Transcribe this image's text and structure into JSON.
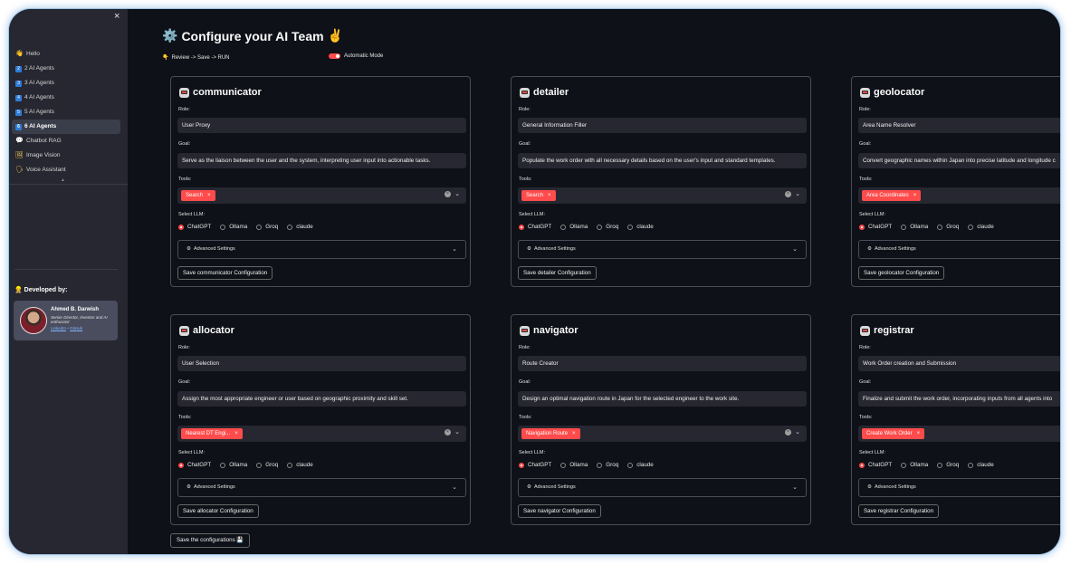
{
  "sidebar": {
    "close_label": "×",
    "items": [
      {
        "icon": "wave-hand-icon",
        "glyph": "👋",
        "label": "Hello",
        "active": false
      },
      {
        "icon": "keycap-2-icon",
        "glyph": "2",
        "label": "2 AI Agents",
        "active": false
      },
      {
        "icon": "keycap-3-icon",
        "glyph": "3",
        "label": "3 AI Agents",
        "active": false
      },
      {
        "icon": "keycap-4-icon",
        "glyph": "4",
        "label": "4 AI Agents",
        "active": false
      },
      {
        "icon": "keycap-5-icon",
        "glyph": "5",
        "label": "5 AI Agents",
        "active": false
      },
      {
        "icon": "keycap-6-icon",
        "glyph": "6",
        "label": "6 AI Agents",
        "active": true
      },
      {
        "icon": "speech-bubble-icon",
        "glyph": "💬",
        "label": "Chatbot RAG",
        "active": false
      },
      {
        "icon": "picture-icon",
        "glyph": "🖼",
        "label": "Image Vision",
        "active": false
      },
      {
        "icon": "microphone-icon",
        "glyph": "🗣",
        "label": "Voice Assistant",
        "active": false
      }
    ],
    "developed_by": "Developed by:",
    "developer": {
      "name": "Ahmed B. Darwish",
      "description": "Senior Director, Inventor and AI enthusiast",
      "link1": "LinkedIn",
      "link_sep": "•",
      "link2": "GitHub"
    }
  },
  "header": {
    "title": "Configure your AI Team",
    "subtitle": "Review -> Save -> RUN",
    "toggle_label": "Automatic Mode"
  },
  "labels": {
    "role": "Role:",
    "goal": "Goal:",
    "tools": "Tools:",
    "select_llm": "Select LLM:",
    "advanced": "Advanced Settings"
  },
  "llm_options": [
    "ChatGPT",
    "Ollama",
    "Groq",
    "claude"
  ],
  "agents": [
    {
      "name": "communicator",
      "role": "User Proxy",
      "goal": "Serve as the liaison between the user and the system, interpreting user input into actionable tasks.",
      "tool": "Search",
      "selected_llm": "ChatGPT",
      "save_label": "Save communicator Configuration"
    },
    {
      "name": "detailer",
      "role": "General Information Filler",
      "goal": "Populate the work order with all necessary details based on the user's input and standard templates.",
      "tool": "Search",
      "selected_llm": "ChatGPT",
      "save_label": "Save detailer Configuration"
    },
    {
      "name": "geolocator",
      "role": "Area Name Resolver",
      "goal": "Convert geographic names within Japan into precise latitude and longitude c",
      "tool": "Area Coordinates",
      "selected_llm": "ChatGPT",
      "save_label": "Save geolocator Configuration"
    },
    {
      "name": "allocator",
      "role": "User Selection",
      "goal": "Assign the most appropriate engineer or user based on geographic proximity and skill set.",
      "tool": "Nearest DT Engi...",
      "selected_llm": "ChatGPT",
      "save_label": "Save allocator Configuration"
    },
    {
      "name": "navigator",
      "role": "Route Creator",
      "goal": "Design an optimal navigation route in Japan for the selected engineer to the work site.",
      "tool": "Navigation Route",
      "selected_llm": "ChatGPT",
      "save_label": "Save navigator Configuration"
    },
    {
      "name": "registrar",
      "role": "Work Order creation and Submission",
      "goal": "Finalize and submit the work order, incorporating inputs from all agents into",
      "tool": "Create Work Order",
      "selected_llm": "ChatGPT",
      "save_label": "Save registrar Configuration"
    }
  ],
  "save_all_label": "Save the configurations"
}
